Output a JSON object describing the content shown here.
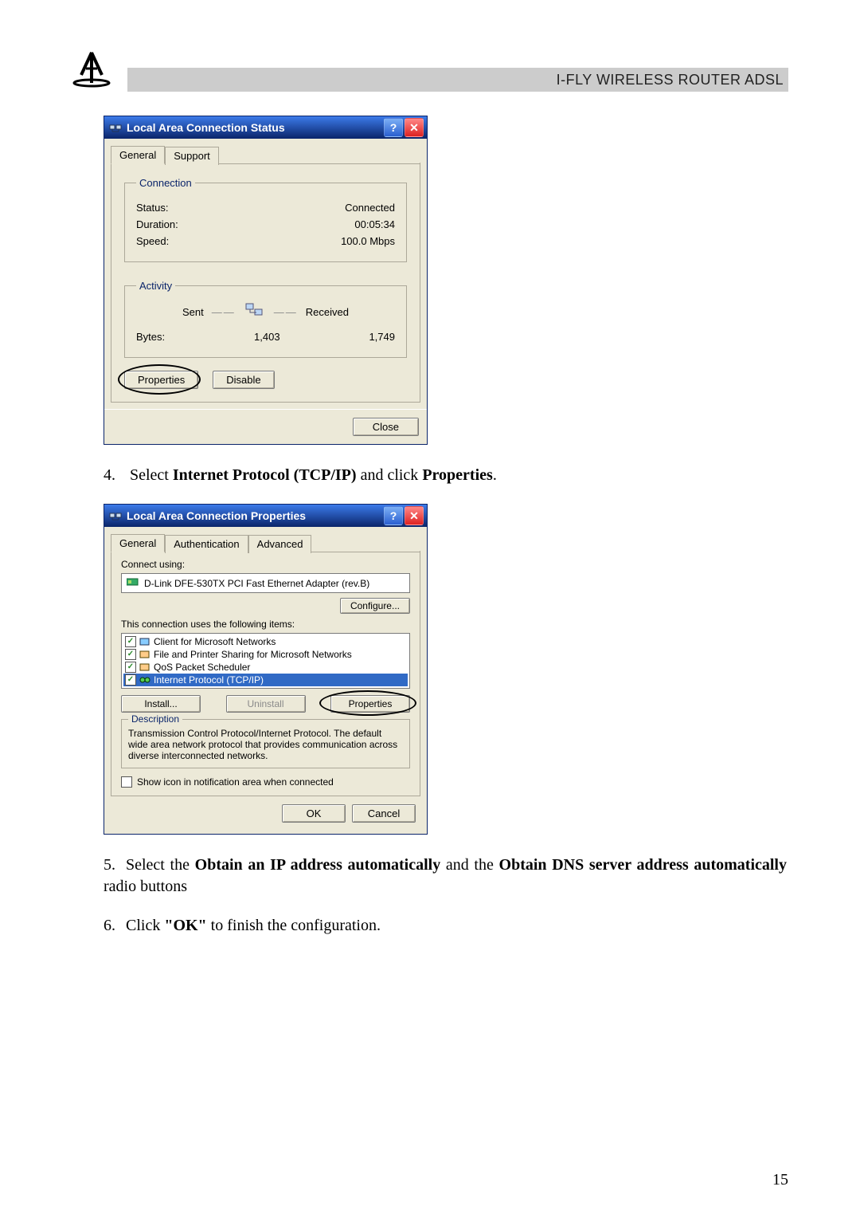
{
  "header": {
    "title": "I-FLY WIRELESS ROUTER ADSL"
  },
  "status_window": {
    "title": "Local Area Connection Status",
    "tabs": {
      "general": "General",
      "support": "Support"
    },
    "connection_legend": "Connection",
    "status_label": "Status:",
    "status_value": "Connected",
    "duration_label": "Duration:",
    "duration_value": "00:05:34",
    "speed_label": "Speed:",
    "speed_value": "100.0 Mbps",
    "activity_legend": "Activity",
    "sent_label": "Sent",
    "received_label": "Received",
    "bytes_label": "Bytes:",
    "bytes_sent": "1,403",
    "bytes_received": "1,749",
    "properties_btn": "Properties",
    "disable_btn": "Disable",
    "close_btn": "Close"
  },
  "instruction4_prefix": "4.",
  "instruction4_a": "Select ",
  "instruction4_b": "Internet Protocol (TCP/IP)",
  "instruction4_c": " and click ",
  "instruction4_d": "Properties",
  "instruction4_e": ".",
  "props_window": {
    "title": "Local Area Connection Properties",
    "tabs": {
      "general": "General",
      "auth": "Authentication",
      "adv": "Advanced"
    },
    "connect_using_label": "Connect using:",
    "adapter": "D-Link DFE-530TX PCI Fast Ethernet Adapter (rev.B)",
    "configure_btn": "Configure...",
    "uses_label": "This connection uses the following items:",
    "items": [
      "Client for Microsoft Networks",
      "File and Printer Sharing for Microsoft Networks",
      "QoS Packet Scheduler",
      "Internet Protocol (TCP/IP)"
    ],
    "install_btn": "Install...",
    "uninstall_btn": "Uninstall",
    "properties_btn": "Properties",
    "description_legend": "Description",
    "description_text": "Transmission Control Protocol/Internet Protocol. The default wide area network protocol that provides communication across diverse interconnected networks.",
    "show_icon_label": "Show icon in notification area when connected",
    "ok_btn": "OK",
    "cancel_btn": "Cancel"
  },
  "instruction5_prefix": "5.",
  "instruction5_a": "Select the ",
  "instruction5_b": "Obtain an IP address automatically",
  "instruction5_c": " and the ",
  "instruction5_d": "Obtain DNS server address automatically",
  "instruction5_e": " radio buttons",
  "instruction6_prefix": "6.",
  "instruction6_a": "Click ",
  "instruction6_b": "\"OK\"",
  "instruction6_c": " to finish the configuration.",
  "page_number": "15"
}
